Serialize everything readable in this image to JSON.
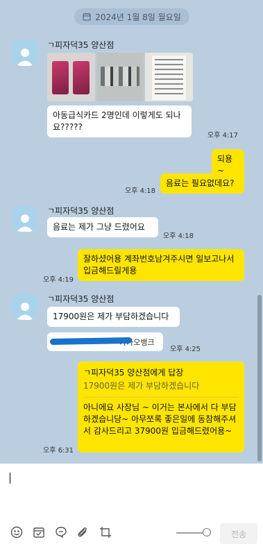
{
  "date_pill": "2024년 1월 8일 월요일",
  "messages": [
    {
      "sender": "ㄱ피자덕35 양산점",
      "text": "아동급식카드 2명인데 이렇게도 되나요?????",
      "time": "오후 4:17"
    },
    {
      "text": "되용~"
    },
    {
      "text": "음료는 필요없데요?",
      "time": "오후 4:18"
    },
    {
      "sender": "ㄱ피자덕35 양산점",
      "text": "음료는 제가 그냥 드렸어요",
      "time": "오후 4:18"
    },
    {
      "text": "잘하셨어용 계좌번호남겨주시면 일보고나서 입금해드릴게용",
      "time": "오후 4:19"
    },
    {
      "sender": "ㄱ피자덕35 양산점",
      "text": "17900원은 제가 부담하겠습니다",
      "redacted_text": "카카오뱅크",
      "time": "오후 4:25"
    },
    {
      "reply_title": "ㄱ피자덕35 양산점에게 답장",
      "reply_quote": "17900원은 제가 부담하겠습니다",
      "text": "아니에요 사장님 ~ 이거는 본사에서 다 부담하겠습니당~ 아무쪼록 좋은일에 동참해주셔서 감사드리고 37900원 입금해드렸어용~",
      "time": "오후 6:31"
    }
  ],
  "input": {
    "send_label": "전송"
  },
  "icons": [
    "calendar-icon",
    "avatar-icon",
    "emoji-icon",
    "schedule-icon",
    "chat-icon",
    "attach-icon",
    "crop-icon"
  ],
  "colors": {
    "chat_bg": "#bacee0",
    "outgoing": "#fee500",
    "incoming": "#ffffff"
  }
}
